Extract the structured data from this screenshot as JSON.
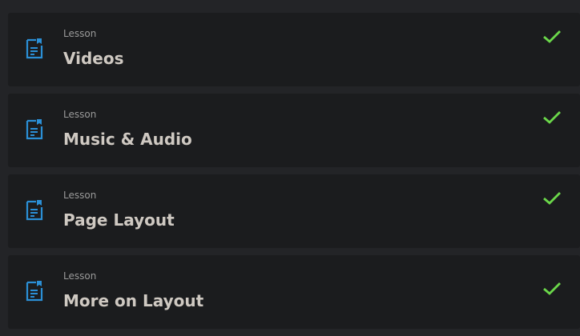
{
  "colors": {
    "background": "#232427",
    "card": "#1b1c1e",
    "icon_blue": "#2b8fd6",
    "check_green": "#6bd84a",
    "title_text": "#cfc9c2",
    "kind_text": "#9a9a9a"
  },
  "lessons": [
    {
      "kind": "Lesson",
      "title": "Videos",
      "icon": "document-bookmark-icon",
      "status": "completed",
      "status_icon": "checkmark-icon"
    },
    {
      "kind": "Lesson",
      "title": "Music & Audio",
      "icon": "document-bookmark-icon",
      "status": "completed",
      "status_icon": "checkmark-icon"
    },
    {
      "kind": "Lesson",
      "title": "Page Layout",
      "icon": "document-bookmark-icon",
      "status": "completed",
      "status_icon": "checkmark-icon"
    },
    {
      "kind": "Lesson",
      "title": "More on Layout",
      "icon": "document-bookmark-icon",
      "status": "completed",
      "status_icon": "checkmark-icon"
    }
  ]
}
